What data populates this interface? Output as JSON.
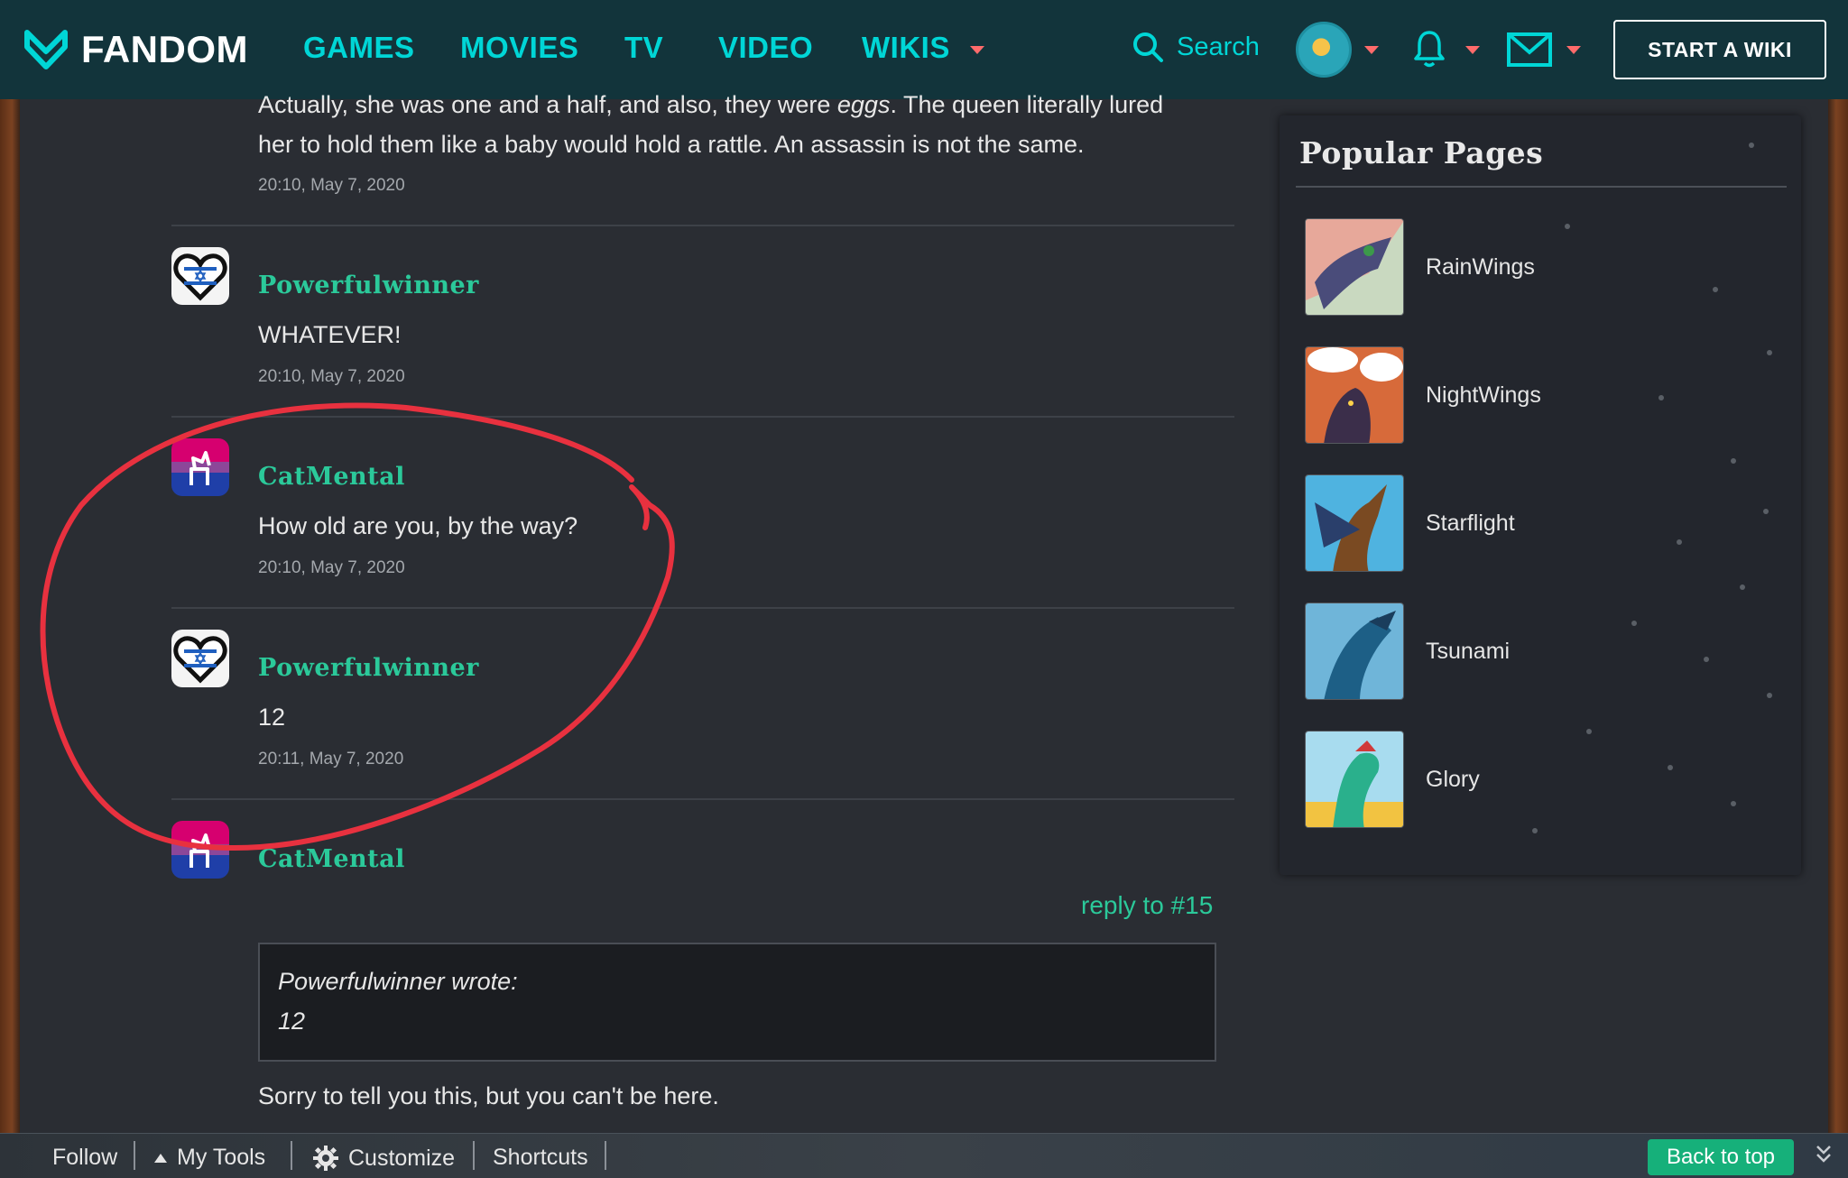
{
  "nav": {
    "logo_text": "FANDOM",
    "links": [
      "GAMES",
      "MOVIES",
      "TV",
      "VIDEO",
      "WIKIS"
    ],
    "search_label": "Search",
    "start_wiki": "START A WIKI"
  },
  "comments": {
    "top_partial": {
      "line1_pre": "Actually, she was one and a half, and also, they were ",
      "line1_em": "eggs",
      "line1_post": ". The queen literally lured",
      "line2": "her to hold them like a baby would hold a rattle. An assassin is not the same.",
      "time": "20:10, May 7, 2020"
    },
    "items": [
      {
        "author": "Powerfulwinner",
        "text": "WHATEVER!",
        "time": "20:10, May 7, 2020"
      },
      {
        "author": "CatMental",
        "text": "How old are you, by the way?",
        "time": "20:10, May 7, 2020"
      },
      {
        "author": "Powerfulwinner",
        "text": "12",
        "time": "20:11, May 7, 2020"
      }
    ],
    "last": {
      "author": "CatMental",
      "reply_link": "reply to #15",
      "quote_header": "Powerfulwinner wrote:",
      "quote_body": "12",
      "text": "Sorry to tell you this, but you can't be here."
    }
  },
  "popular": {
    "title": "Popular Pages",
    "items": [
      "RainWings",
      "NightWings",
      "Starflight",
      "Tsunami",
      "Glory"
    ]
  },
  "toolbar": {
    "follow": "Follow",
    "my_tools": "My Tools",
    "customize": "Customize",
    "shortcuts": "Shortcuts",
    "back_to_top": "Back to top"
  },
  "colors": {
    "nav_bg": "#12343b",
    "accent_cyan": "#00d6d6",
    "author_green": "#2bc99a",
    "annotation_red": "#e8313f"
  }
}
